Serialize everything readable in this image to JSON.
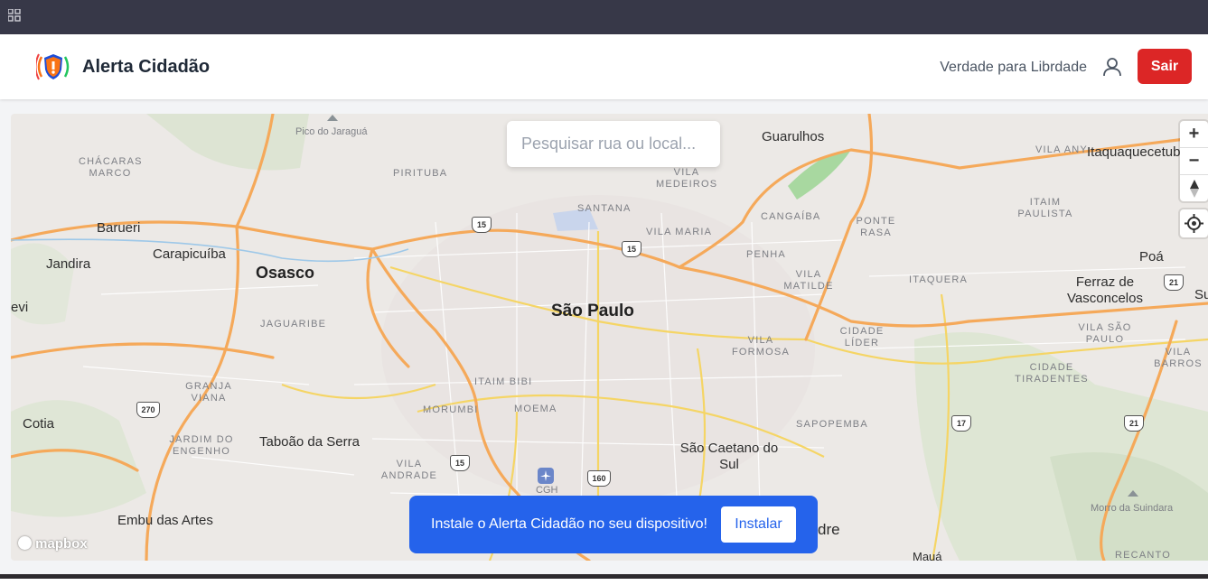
{
  "app": {
    "title": "Alerta Cidadão",
    "user_name": "Verdade para Librdade",
    "logout_label": "Sair",
    "logout_color": "#dc2626"
  },
  "map": {
    "search_placeholder": "Pesquisar rua ou local...",
    "attribution_logo": "mapbox",
    "controls": {
      "zoom_in": "+",
      "zoom_out": "−",
      "compass_icon": "compass-icon",
      "locate_icon": "crosshair-icon"
    },
    "city_labels": [
      "São Paulo",
      "Osasco",
      "Guarulhos",
      "Barueri",
      "Carapicuíba",
      "Jandira",
      "Cotia",
      "Taboão da Serra",
      "Embu das Artes",
      "São Caetano do Sul",
      "Itaquaquecetub",
      "Poá",
      "Ferraz de Vasconcelos",
      "Mauá",
      "evi",
      "Su",
      "dre"
    ],
    "neighborhood_labels": [
      "Pico do Jaraguá",
      "CHÁCARAS MARCO",
      "PIRITUBA",
      "SANTANA",
      "VILA MEDEIROS",
      "VILA MARIA",
      "CANGAÍBA",
      "PONTE RASA",
      "ITAIM PAULISTA",
      "VILA ANY",
      "PENHA",
      "VILA MATILDE",
      "ITAQUERA",
      "JAGUARIBE",
      "CIDADE LÍDER",
      "VILA FORMOSA",
      "VILA SÃO PAULO",
      "VILA BARROS",
      "CIDADE TIRADENTES",
      "ITAIM BIBI",
      "MOEMA",
      "MORUMBI",
      "GRANJA VIANA",
      "JARDIM DO ENGENHO",
      "VILA ANDRADE",
      "SAPOPEMBA",
      "CGH",
      "Morro da Suindara",
      "RECANTO"
    ],
    "road_shields": [
      "15",
      "15",
      "15",
      "270",
      "160",
      "17",
      "21",
      "21"
    ]
  },
  "install_banner": {
    "text": "Instale o Alerta Cidadão no seu dispositivo!",
    "button_label": "Instalar",
    "color": "#2563eb"
  }
}
